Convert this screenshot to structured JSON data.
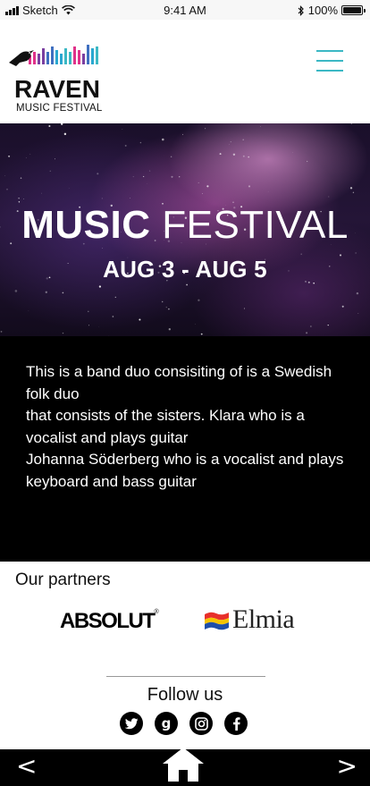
{
  "status_bar": {
    "carrier": "Sketch",
    "time": "9:41 AM",
    "battery_percent": "100%",
    "battery_level": 1.0
  },
  "header": {
    "logo_title": "RAVEN",
    "logo_subtitle": "MUSIC FESTIVAL",
    "menu_icon": "hamburger-icon",
    "accent_color": "#3bb8c4"
  },
  "hero": {
    "title_bold": "MUSIC",
    "title_light": "FESTIVAL",
    "dates": "AUG 3 - AUG 5"
  },
  "description": {
    "lines": [
      "This is a band duo consisiting of  is a Swedish folk duo",
      "that consists of the sisters. Klara  who is a vocalist  and plays guitar",
      "Johanna Söderberg  who is  a vocalist and plays keyboard and bass guitar"
    ]
  },
  "partners": {
    "title": "Our partners",
    "logos": [
      {
        "name": "ABSOLUT",
        "mark": "®"
      },
      {
        "name": "Elmia"
      }
    ]
  },
  "follow": {
    "title": "Follow us",
    "socials": [
      "twitter-icon",
      "google-plus-icon",
      "instagram-icon",
      "facebook-icon"
    ]
  },
  "bottom_nav": {
    "prev_label": "<",
    "next_label": ">",
    "home_icon": "home-icon"
  }
}
